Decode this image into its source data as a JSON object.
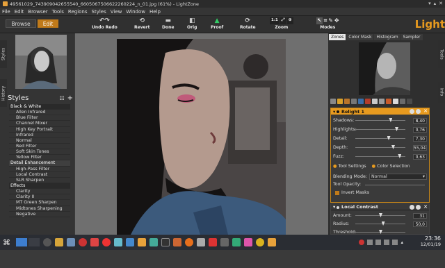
{
  "window": {
    "title": "49561029_743909042655540_6605067506622260224_n_01.jpg (61%) - LightZone"
  },
  "menu": [
    "File",
    "Edit",
    "Browser",
    "Tools",
    "Regions",
    "Styles",
    "View",
    "Window",
    "Help"
  ],
  "toolbar": {
    "undo_redo": "Undo Redo",
    "revert": "Revert",
    "done": "Done",
    "orig": "Orig",
    "proof": "Proof",
    "rotate": "Rotate",
    "zoom": "Zoom",
    "zoom_value": "1:1",
    "modes": "Modes"
  },
  "modes": {
    "browse": "Browse",
    "edit": "Edit"
  },
  "side_tabs": {
    "styles": "Styles",
    "history": "History",
    "tools": "Tools",
    "info": "Info"
  },
  "brand": "Light",
  "styles": {
    "heading": "Styles",
    "items": [
      {
        "label": "Black & White",
        "type": "head"
      },
      {
        "label": "Allen Infrared"
      },
      {
        "label": "Blue Filter"
      },
      {
        "label": "Channel Mixer"
      },
      {
        "label": "High Key Portrait"
      },
      {
        "label": "Infrared"
      },
      {
        "label": "Normal"
      },
      {
        "label": "Red Filter"
      },
      {
        "label": "Soft Skin Tones"
      },
      {
        "label": "Yellow Filter"
      },
      {
        "label": "Detail Enhancement",
        "type": "head"
      },
      {
        "label": "High-Pass Filter"
      },
      {
        "label": "Local Contrast"
      },
      {
        "label": "SLR Sharpen"
      },
      {
        "label": "Effects",
        "type": "head"
      },
      {
        "label": "Clarity"
      },
      {
        "label": "Clarity II"
      },
      {
        "label": "MT Green Sharpen"
      },
      {
        "label": "Midtones Sharpening"
      },
      {
        "label": "Negative"
      }
    ]
  },
  "right_tabs": [
    "Zones",
    "Color Mask",
    "Histogram",
    "Sampler"
  ],
  "relight": {
    "title": "Relight 1",
    "params": [
      {
        "label": "Shadows:",
        "value": "8,40",
        "level": 0.7
      },
      {
        "label": "Highlights:",
        "value": "0,76",
        "level": 0.82
      },
      {
        "label": "Detail:",
        "value": "7,30",
        "level": 0.66
      },
      {
        "label": "Depth:",
        "value": "55,04",
        "level": 0.75
      },
      {
        "label": "Fuzz:",
        "value": "0,63",
        "level": 0.88
      }
    ],
    "tab_settings": "Tool Settings",
    "tab_color": "Color Selection",
    "blend_label": "Blending Mode:",
    "blend_value": "Normal",
    "opacity_label": "Tool Opacity:",
    "invert_label": "Invert Masks"
  },
  "local_contrast": {
    "title": "Local Contrast",
    "params": [
      {
        "label": "Amount:",
        "value": "31",
        "level": 0.5
      },
      {
        "label": "Radius:",
        "value": "50,0",
        "level": 0.55
      },
      {
        "label": "Threshold:",
        "value": "",
        "level": 0.5
      }
    ]
  },
  "clock": {
    "time": "23:36",
    "date": "12/01/19"
  },
  "colors": {
    "accent": "#e79a1f",
    "panel": "#3a3a3a",
    "canvas": "#6f6f6f"
  }
}
